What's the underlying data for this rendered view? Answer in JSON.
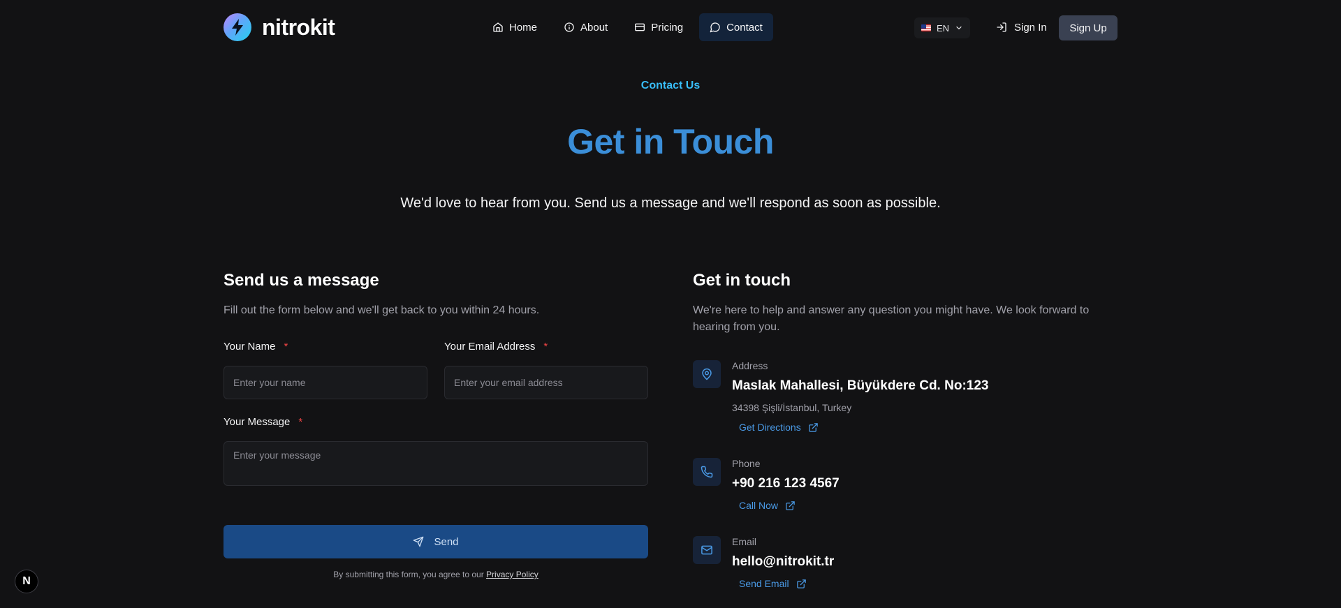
{
  "brand": {
    "name": "nitrokit"
  },
  "nav": {
    "items": [
      {
        "label": "Home",
        "icon": "home-icon"
      },
      {
        "label": "About",
        "icon": "info-icon"
      },
      {
        "label": "Pricing",
        "icon": "credit-card-icon"
      },
      {
        "label": "Contact",
        "icon": "message-circle-icon",
        "active": true
      }
    ]
  },
  "lang": {
    "code": "EN"
  },
  "auth": {
    "sign_in": "Sign In",
    "sign_up": "Sign Up"
  },
  "hero": {
    "eyebrow": "Contact Us",
    "title": "Get in Touch",
    "subtitle": "We'd love to hear from you. Send us a message and we'll respond as soon as possible."
  },
  "form": {
    "title": "Send us a message",
    "description": "Fill out the form below and we'll get back to you within 24 hours.",
    "name_label": "Your Name",
    "name_placeholder": "Enter your name",
    "email_label": "Your Email Address",
    "email_placeholder": "Enter your email address",
    "message_label": "Your Message",
    "message_placeholder": "Enter your message",
    "required_mark": "*",
    "send_label": "Send",
    "terms_prefix": "By submitting this form, you agree to our",
    "terms_link": "Privacy Policy"
  },
  "info": {
    "title": "Get in touch",
    "description": "We're here to help and answer any question you might have. We look forward to hearing from you.",
    "address": {
      "label": "Address",
      "value": "Maslak Mahallesi, Büyükdere Cd. No:123",
      "sub": "34398 Şişli/İstanbul, Turkey",
      "link": "Get Directions"
    },
    "phone": {
      "label": "Phone",
      "value": "+90 216 123 4567",
      "link": "Call Now"
    },
    "email": {
      "label": "Email",
      "value": "hello@nitrokit.tr",
      "link": "Send Email"
    }
  },
  "dev_badge": {
    "letter": "N"
  },
  "colors": {
    "accent": "#3b8ed8",
    "eyebrow": "#38bdf8",
    "button": "#1a4a86",
    "link": "#4a9ae6",
    "required": "#ef4444"
  }
}
